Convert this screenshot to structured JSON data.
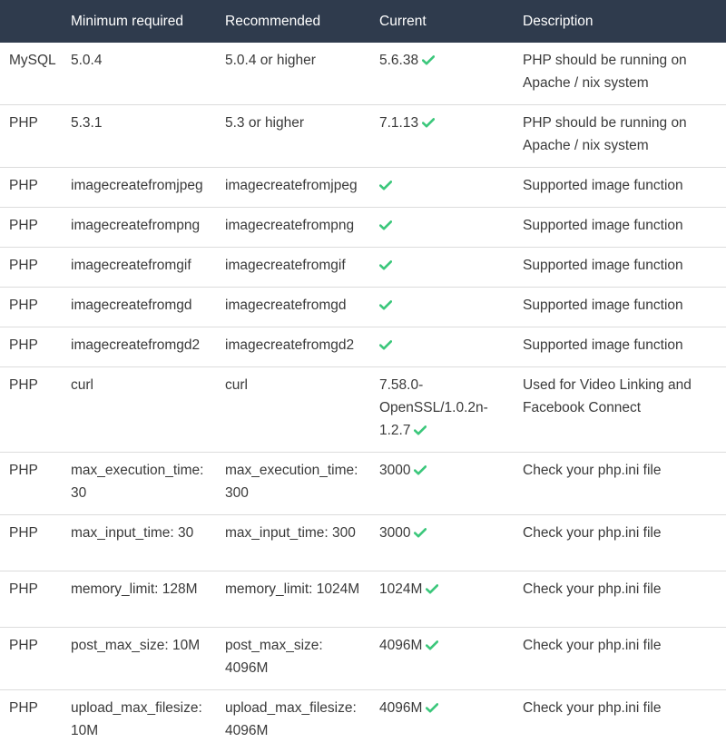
{
  "headers": [
    "",
    "Minimum required",
    "Recommended",
    "Current",
    "Description"
  ],
  "colors": {
    "header_bg": "#2f3b4d",
    "header_text": "#ffffff",
    "check_color": "#3bc77b",
    "row_border": "#dcdcdc",
    "body_text": "#3a3a3a"
  },
  "check_icon": "checkmark-icon",
  "rows": [
    {
      "type": "MySQL",
      "min": "5.0.4",
      "recommended": "5.0.4 or higher",
      "current": "5.6.38",
      "check": true,
      "description": "PHP should be running on Apache / nix system"
    },
    {
      "type": "PHP",
      "min": "5.3.1",
      "recommended": "5.3 or higher",
      "current": "7.1.13",
      "check": true,
      "description": "PHP should be running on Apache / nix system"
    },
    {
      "type": "PHP",
      "min": "imagecreatefromjpeg",
      "recommended": "imagecreatefromjpeg",
      "current": "",
      "check": true,
      "description": "Supported image function"
    },
    {
      "type": "PHP",
      "min": "imagecreatefrompng",
      "recommended": "imagecreatefrompng",
      "current": "",
      "check": true,
      "description": "Supported image function"
    },
    {
      "type": "PHP",
      "min": "imagecreatefromgif",
      "recommended": "imagecreatefromgif",
      "current": "",
      "check": true,
      "description": "Supported image function"
    },
    {
      "type": "PHP",
      "min": "imagecreatefromgd",
      "recommended": "imagecreatefromgd",
      "current": "",
      "check": true,
      "description": "Supported image function"
    },
    {
      "type": "PHP",
      "min": "imagecreatefromgd2",
      "recommended": "imagecreatefromgd2",
      "current": "",
      "check": true,
      "description": "Supported image function"
    },
    {
      "type": "PHP",
      "min": "curl",
      "recommended": "curl",
      "current": "7.58.0-OpenSSL/1.0.2n-1.2.7",
      "check": true,
      "description": "Used for Video Linking and Facebook Connect"
    },
    {
      "type": "PHP",
      "min": "max_execution_time: 30",
      "recommended": "max_execution_time: 300",
      "current": "3000",
      "check": true,
      "description": "Check your php.ini file"
    },
    {
      "type": "PHP",
      "min": "max_input_time: 30",
      "recommended": "max_input_time: 300",
      "current": "3000",
      "check": true,
      "description": "Check your php.ini file"
    },
    {
      "type": "PHP",
      "min": "memory_limit: 128M",
      "recommended": "memory_limit: 1024M",
      "current": "1024M",
      "check": true,
      "description": "Check your php.ini file"
    },
    {
      "type": "PHP",
      "min": "post_max_size: 10M",
      "recommended": "post_max_size: 4096M",
      "current": "4096M",
      "check": true,
      "description": "Check your php.ini file"
    },
    {
      "type": "PHP",
      "min": "upload_max_filesize: 10M",
      "recommended": "upload_max_filesize: 4096M",
      "current": "4096M",
      "check": true,
      "description": "Check your php.ini file"
    }
  ]
}
